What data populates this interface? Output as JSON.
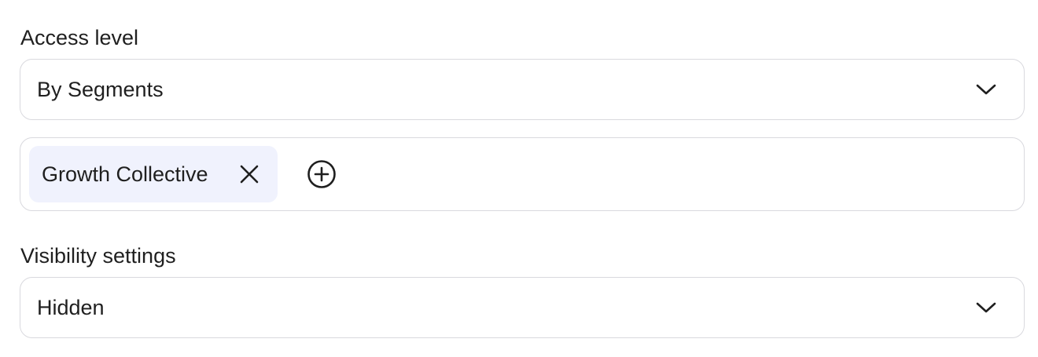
{
  "access": {
    "label": "Access level",
    "selected": "By Segments",
    "icon": "chevron-down-icon"
  },
  "segments": {
    "chips": [
      {
        "label": "Growth Collective",
        "remove_icon": "close-icon"
      }
    ],
    "add_icon": "plus-circle-icon"
  },
  "visibility": {
    "label": "Visibility settings",
    "selected": "Hidden",
    "icon": "chevron-down-icon"
  }
}
